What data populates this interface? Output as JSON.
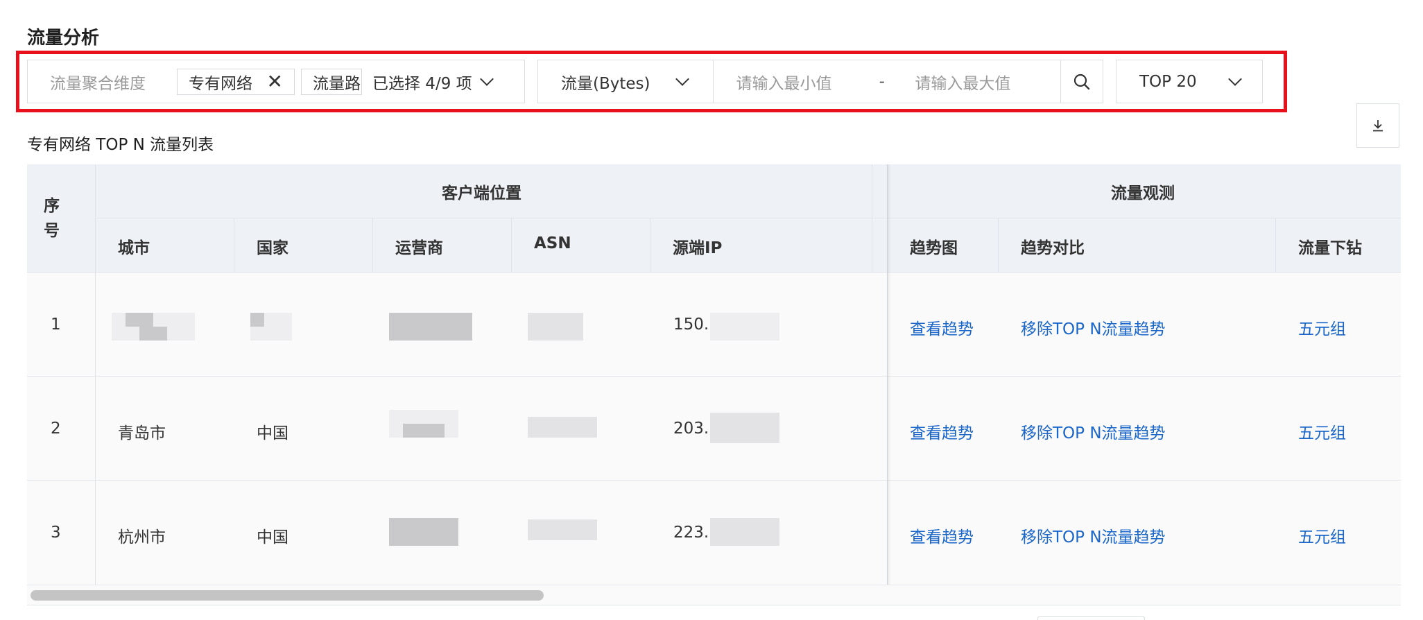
{
  "page_title": "流量分析",
  "filters": {
    "dimension_label": "流量聚合维度",
    "selected_tags": [
      "专有网络",
      "流量路径"
    ],
    "selected_count": "已选择 4/9 项",
    "metric": "流量(Bytes)",
    "min_placeholder": "请输入最小值",
    "range_separator": "-",
    "max_placeholder": "请输入最大值",
    "top_n": "TOP 20"
  },
  "table": {
    "title": "专有网络 TOP N 流量列表",
    "group_headers": {
      "index": "序号",
      "client_location": "客户端位置",
      "traffic_observe": "流量观测"
    },
    "columns": {
      "city": "城市",
      "country": "国家",
      "isp": "运营商",
      "asn": "ASN",
      "src_ip": "源端IP",
      "trend": "趋势图",
      "compare": "趋势对比",
      "drilldown": "流量下钻"
    },
    "rows": [
      {
        "index": "1",
        "city": "",
        "country": "",
        "src_ip": "150.",
        "trend": "查看趋势",
        "compare": "移除TOP N流量趋势",
        "drilldown": "五元组"
      },
      {
        "index": "2",
        "city": "青岛市",
        "country": "中国",
        "src_ip": "203.",
        "trend": "查看趋势",
        "compare": "移除TOP N流量趋势",
        "drilldown": "五元组"
      },
      {
        "index": "3",
        "city": "杭州市",
        "country": "中国",
        "src_ip": "223.",
        "trend": "查看趋势",
        "compare": "移除TOP N流量趋势",
        "drilldown": "五元组"
      }
    ]
  },
  "icons": [
    "close-icon",
    "chevron-down-icon",
    "search-icon",
    "download-icon"
  ],
  "colors": {
    "accent_link": "#1b66c9",
    "highlight_border": "#e8101a",
    "header_bg": "#eef1f5"
  }
}
